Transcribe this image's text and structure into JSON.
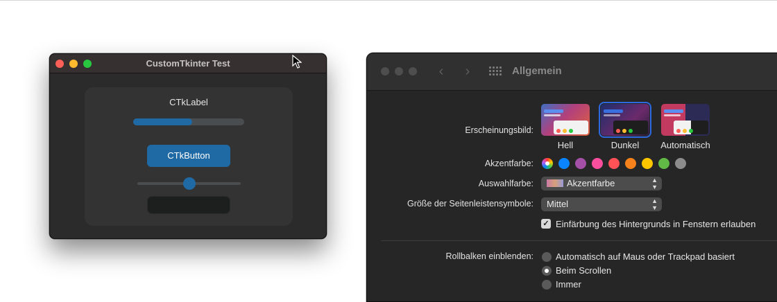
{
  "ctk_window": {
    "title": "CustomTkinter Test",
    "label": "CTkLabel",
    "progress_fraction": 0.53,
    "button_label": "CTkButton",
    "slider_fraction": 0.5,
    "accent_color": "#1f6aa5"
  },
  "prefs_window": {
    "title": "Allgemein",
    "toolbar_icons": [
      "back-icon",
      "forward-icon",
      "grid-icon"
    ],
    "appearance": {
      "label": "Erscheinungsbild:",
      "options": [
        {
          "label": "Hell",
          "selected": false
        },
        {
          "label": "Dunkel",
          "selected": true
        },
        {
          "label": "Automatisch",
          "selected": false
        }
      ]
    },
    "accent": {
      "label": "Akzentfarbe:",
      "colors": [
        "multicolor",
        "#0a84ff",
        "#a550a7",
        "#f74f9e",
        "#ff5257",
        "#f7821b",
        "#ffc600",
        "#62ba46",
        "#8c8c8c"
      ]
    },
    "highlight": {
      "label": "Auswahlfarbe:",
      "value": "Akzentfarbe"
    },
    "sidebar_size": {
      "label": "Größe der Seitenleistensymbole:",
      "value": "Mittel"
    },
    "tinting": {
      "label": "Einfärbung des Hintergrunds in Fenstern erlauben",
      "checked": true
    },
    "scrollbars": {
      "label": "Rollbalken einblenden:",
      "options": [
        {
          "label": "Automatisch auf Maus oder Trackpad basiert",
          "selected": false
        },
        {
          "label": "Beim Scrollen",
          "selected": true
        },
        {
          "label": "Immer",
          "selected": false
        }
      ]
    }
  }
}
